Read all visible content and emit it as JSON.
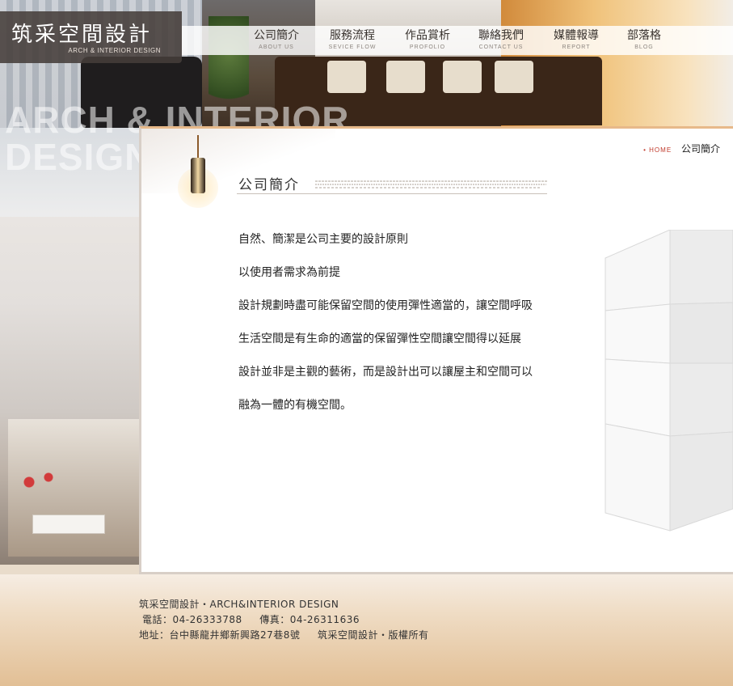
{
  "brand": {
    "name": "筑采空間設計",
    "tagline": "ARCH & INTERIOR DESIGN",
    "watermark_lines": [
      "ARCH & INTERIOR",
      "DESIGN"
    ]
  },
  "nav": [
    {
      "label": "公司簡介",
      "sub": "ABOUT US"
    },
    {
      "label": "服務流程",
      "sub": "SEVICE FLOW"
    },
    {
      "label": "作品賞析",
      "sub": "PROFOLIO"
    },
    {
      "label": "聯絡我們",
      "sub": "CONTACT US"
    },
    {
      "label": "媒體報導",
      "sub": "REPORT"
    },
    {
      "label": "部落格",
      "sub": "BLOG"
    }
  ],
  "breadcrumb": {
    "home": "HOME",
    "current": "公司簡介"
  },
  "page": {
    "title": "公司簡介",
    "paragraphs": [
      "自然、簡潔是公司主要的設計原則",
      "以使用者需求為前提",
      "設計規劃時盡可能保留空間的使用彈性適當的，讓空間呼吸",
      "生活空間是有生命的適當的保留彈性空間讓空間得以延展",
      "設計並非是主觀的藝術，而是設計出可以讓屋主和空間可以",
      "融為一體的有機空間。"
    ]
  },
  "footer": {
    "line1": "筑采空間設計・ARCH&INTERIOR DESIGN",
    "phone_label": "電話：",
    "phone": "04-26333788",
    "fax_label": "傳真：",
    "fax": "04-26311636",
    "address_label": "地址：",
    "address": "台中縣龍井鄉新興路27巷8號",
    "copyright": "筑采空間設計・版權所有"
  },
  "colors": {
    "accent": "#c0392b",
    "panel_border": "#e7b98a",
    "footer_tan": "#e2bf95"
  }
}
